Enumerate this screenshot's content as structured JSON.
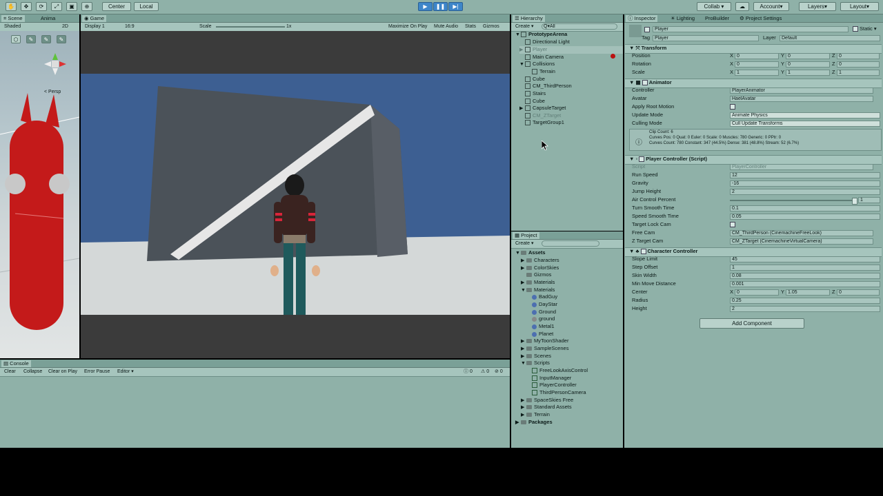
{
  "toolbar": {
    "pivot": "Center",
    "space": "Local",
    "collab": "Collab ▾",
    "account": "Account",
    "layers": "Layers",
    "layout": "Layout"
  },
  "scene": {
    "tab_scene": "Scene",
    "tab_anim": "Anima",
    "shading": "Shaded",
    "mode2d": "2D",
    "persp": "< Persp"
  },
  "game": {
    "tab": "Game",
    "display": "Display 1",
    "aspect": "16:9",
    "scale_label": "Scale",
    "scale_value": "1x",
    "maximize": "Maximize On Play",
    "mute": "Mute Audio",
    "stats": "Stats",
    "gizmos": "Gizmos"
  },
  "hierarchy": {
    "tab": "Hierarchy",
    "create": "Create",
    "search": "Q▾All",
    "root": "PrototypeArena",
    "items": [
      {
        "label": "Directional Light"
      },
      {
        "label": "Player"
      },
      {
        "label": "Main Camera"
      },
      {
        "label": "Collisions"
      },
      {
        "label": "Terrain"
      },
      {
        "label": "Cube"
      },
      {
        "label": "CM_ThirdPerson"
      },
      {
        "label": "Stairs"
      },
      {
        "label": "Cube"
      },
      {
        "label": "CapsuleTarget"
      },
      {
        "label": "CM_ZTarget"
      },
      {
        "label": "TargetGroup1"
      }
    ]
  },
  "project": {
    "tab": "Project",
    "create": "Create",
    "assets": "Assets",
    "folders": [
      "Characters",
      "ColorSkies",
      "Gizmos",
      "Materials",
      "Materials"
    ],
    "materials": [
      "BadGuy",
      "DayStar",
      "Ground",
      "ground",
      "Metal1",
      "Planet"
    ],
    "folders2": [
      "MyToonShader",
      "SampleScenes",
      "Scenes",
      "Scripts"
    ],
    "scripts": [
      "FreeLookAxisControl",
      "InputManager",
      "PlayerController",
      "ThirdPersonCamera"
    ],
    "folders3": [
      "SpaceSkies Free",
      "Standard Assets",
      "Terrain"
    ],
    "packages": "Packages"
  },
  "console": {
    "tab": "Console",
    "clear": "Clear",
    "collapse": "Collapse",
    "clear_on_play": "Clear on Play",
    "error_pause": "Error Pause",
    "editor": "Editor ▾",
    "c1": "0",
    "c2": "0",
    "c3": "0"
  },
  "inspector": {
    "tab": "Inspector",
    "tab_lighting": "Lighting",
    "tab_probuilder": "ProBuilder",
    "tab_settings": "Project Settings",
    "name": "Player",
    "static": "Static ▾",
    "tag_label": "Tag",
    "tag": "Player",
    "layer_label": "Layer",
    "layer": "Default",
    "transform": {
      "title": "Transform",
      "position": "Position",
      "rotation": "Rotation",
      "scale": "Scale",
      "pos": [
        "0",
        "0",
        "0"
      ],
      "rot": [
        "0",
        "0",
        "0"
      ],
      "scl": [
        "1",
        "1",
        "1"
      ]
    },
    "animator": {
      "title": "Animator",
      "controller_label": "Controller",
      "controller": "PlayerAnimator",
      "avatar_label": "Avatar",
      "avatar": "HaelAvatar",
      "root_motion": "Apply Root Motion",
      "update_mode_label": "Update Mode",
      "update_mode": "Animate Physics",
      "culling_label": "Culling Mode",
      "culling": "Cull Update Transforms",
      "info1": "Clip Count: 6",
      "info2": "Curves Pos: 0 Quat: 0 Euler: 0 Scale: 0 Muscles: 780 Generic: 0 PPtr: 0",
      "info3": "Curves Count: 780 Constant: 347 (44.5%) Dense: 381 (48.8%) Stream: 52 (6.7%)"
    },
    "player_controller": {
      "title": "Player Controller (Script)",
      "script_label": "Script",
      "script": "PlayerController",
      "rows": [
        {
          "label": "Run Speed",
          "value": "12"
        },
        {
          "label": "Gravity",
          "value": "-16"
        },
        {
          "label": "Jump Height",
          "value": "2"
        },
        {
          "label": "Air Control Percent",
          "value": "1"
        },
        {
          "label": "Turn Smooth Time",
          "value": "0.1"
        },
        {
          "label": "Speed Smooth Time",
          "value": "0.05"
        },
        {
          "label": "Target Lock Cam",
          "value": ""
        },
        {
          "label": "Free Cam",
          "value": "CM_ThirdPerson (CinemachineFreeLook)"
        },
        {
          "label": "Z Target Cam",
          "value": "CM_ZTarget (CinemachineVirtualCamera)"
        }
      ]
    },
    "character_controller": {
      "title": "Character Controller",
      "rows": [
        {
          "label": "Slope Limit",
          "value": "45"
        },
        {
          "label": "Step Offset",
          "value": "1"
        },
        {
          "label": "Skin Width",
          "value": "0.08"
        },
        {
          "label": "Min Move Distance",
          "value": "0.001"
        }
      ],
      "center_label": "Center",
      "center": [
        "0",
        "1.05",
        "0"
      ],
      "radius_label": "Radius",
      "radius": "0.25",
      "height_label": "Height",
      "height": "2"
    },
    "add_component": "Add Component"
  },
  "colors": {
    "panel": "#8fb1a8",
    "sky": "#3d5f92",
    "wall": "#4b5259",
    "ground": "#d4d8d8",
    "red_character": "#c41a1a"
  }
}
